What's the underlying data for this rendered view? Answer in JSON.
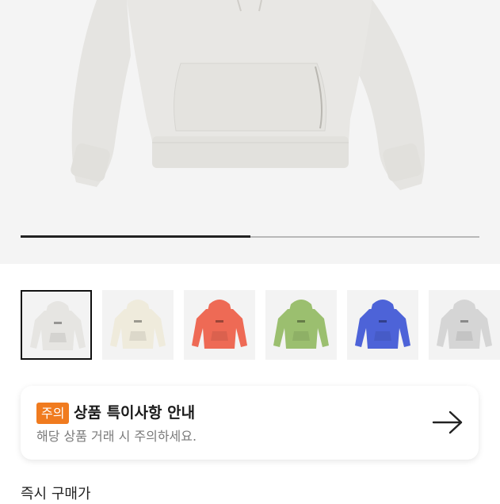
{
  "hero": {
    "image_icon": "hoodie-product-photo",
    "image_color": "#e8e7e4",
    "slider_progress": 0.5
  },
  "thumbnails": [
    {
      "color": "#e6e5e2",
      "icon": "hoodie-thumbnail-icon",
      "selected": true
    },
    {
      "color": "#efebdc",
      "icon": "hoodie-thumbnail-icon",
      "selected": false
    },
    {
      "color": "#ee6a55",
      "icon": "hoodie-thumbnail-icon",
      "selected": false
    },
    {
      "color": "#9bbf6f",
      "icon": "hoodie-thumbnail-icon",
      "selected": false
    },
    {
      "color": "#4d63d8",
      "icon": "hoodie-thumbnail-icon",
      "selected": false
    },
    {
      "color": "#d5d5d5",
      "icon": "hoodie-thumbnail-icon",
      "selected": false
    }
  ],
  "notice": {
    "badge": "주의",
    "title": "상품 특이사항 안내",
    "description": "해당 상품 거래 시 주의하세요.",
    "arrow_icon": "arrow-right-icon",
    "badge_color": "#f07b1f"
  },
  "section": {
    "label": "즉시 구매가"
  }
}
